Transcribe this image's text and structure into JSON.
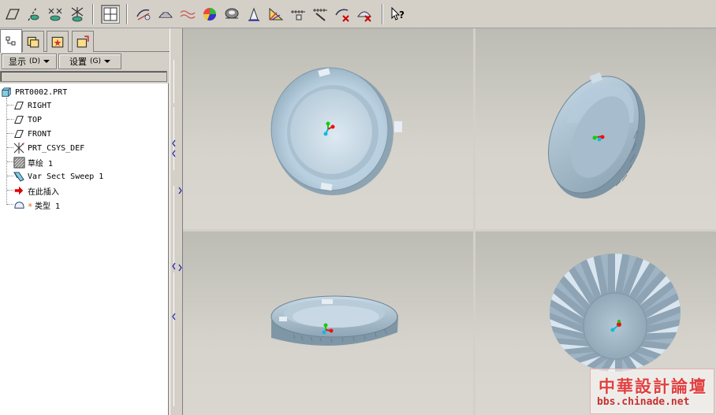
{
  "toolbar": {
    "icons": [
      "datum-plane-icon",
      "datum-axis-icon",
      "datum-point-icon",
      "coord-sys-icon",
      "layout-icon",
      "sketch-icon",
      "surface-icon",
      "wave-icon",
      "color-icon",
      "shade-icon",
      "draft-icon",
      "analysis-icon",
      "measure-icon",
      "curve-icon",
      "delete-curve-icon",
      "delete-surface-icon",
      "context-help-icon"
    ]
  },
  "left_panel": {
    "tabs": [
      "model-tree-tab",
      "folder-tab",
      "favorites-tab",
      "connections-tab"
    ],
    "display_menu": "显示",
    "display_key": "(D)",
    "settings_menu": "设置",
    "settings_key": "(G)",
    "tree": [
      {
        "label": "PRT0002.PRT",
        "icon": "part-icon"
      },
      {
        "label": "RIGHT",
        "icon": "datum-plane-icon"
      },
      {
        "label": "TOP",
        "icon": "datum-plane-icon"
      },
      {
        "label": "FRONT",
        "icon": "datum-plane-icon"
      },
      {
        "label": "PRT_CSYS_DEF",
        "icon": "csys-icon"
      },
      {
        "label": "草绘 1",
        "icon": "sketch-icon"
      },
      {
        "label": "Var Sect Sweep 1",
        "icon": "sweep-icon"
      },
      {
        "label": "在此插入",
        "icon": "insert-arrow-icon"
      },
      {
        "label": "类型 1",
        "icon": "type-icon"
      }
    ]
  },
  "watermark": {
    "title": "中華設計論壇",
    "url": "bbs.chinade.net"
  }
}
